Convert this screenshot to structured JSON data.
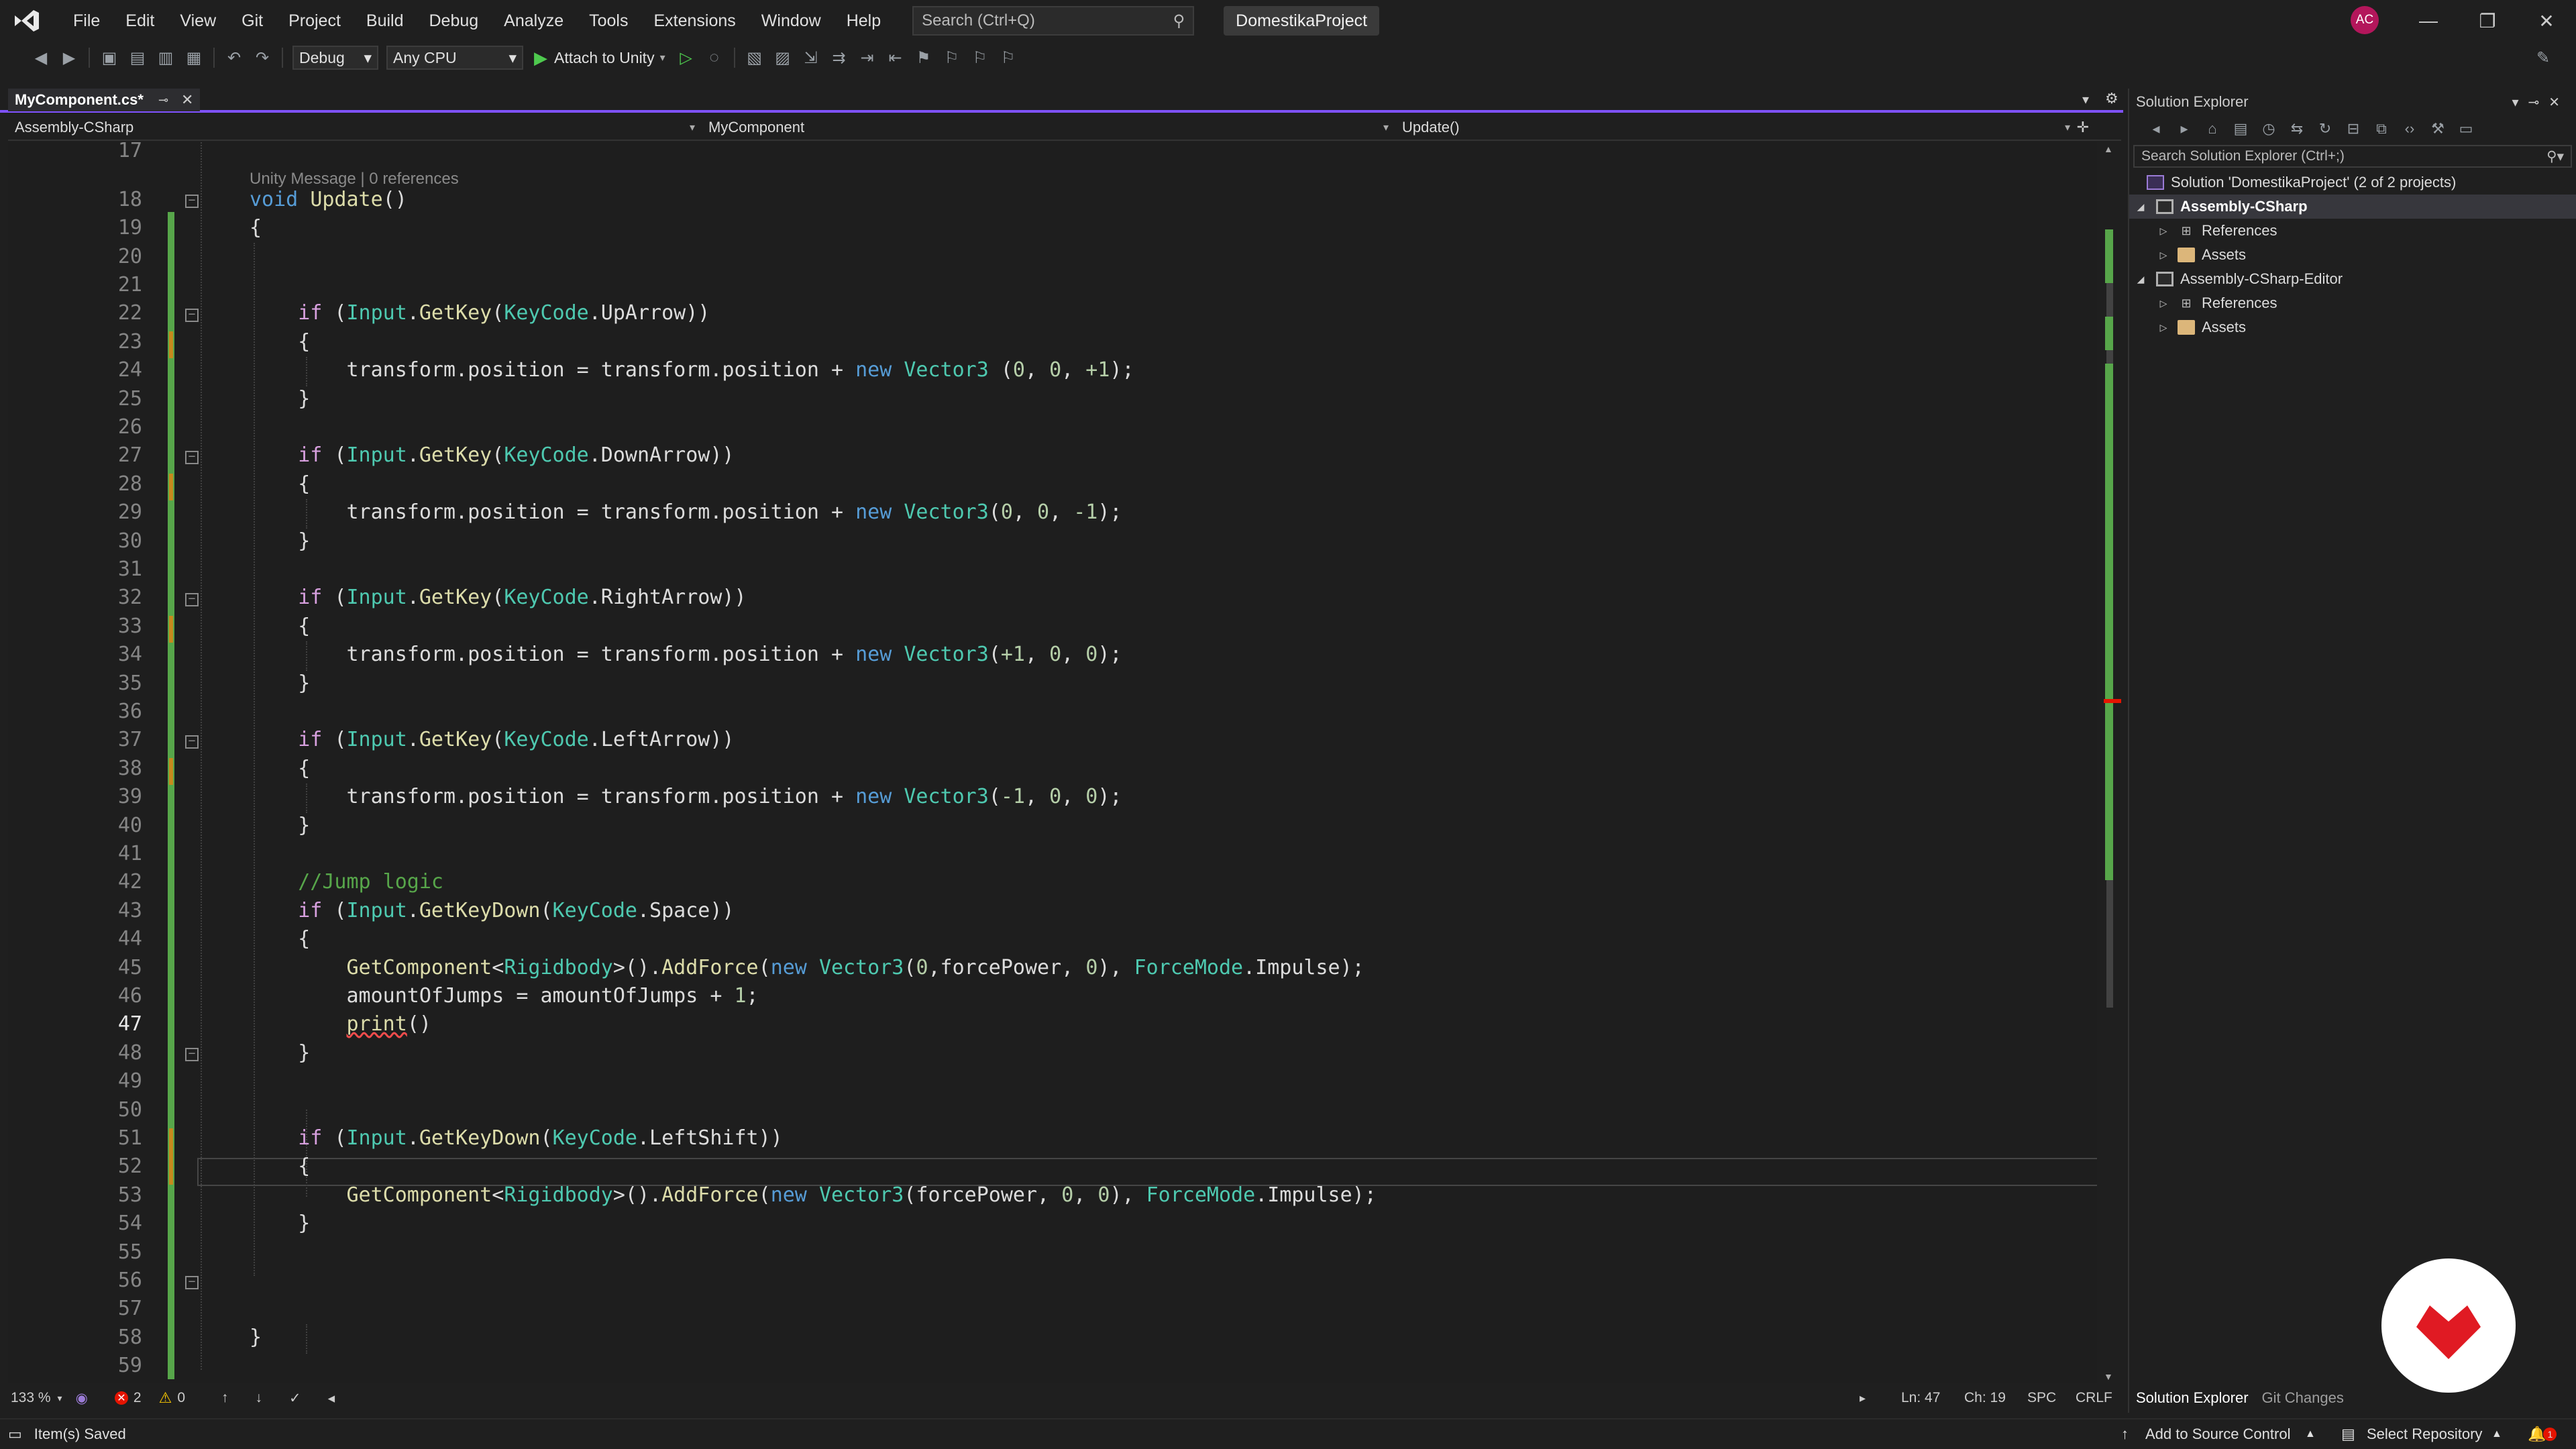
{
  "menu": [
    "File",
    "Edit",
    "View",
    "Git",
    "Project",
    "Build",
    "Debug",
    "Analyze",
    "Tools",
    "Extensions",
    "Window",
    "Help"
  ],
  "search": {
    "placeholder": "Search (Ctrl+Q)"
  },
  "project_name": "DomestikaProject",
  "user_initials": "AC",
  "toolbar": {
    "config": "Debug",
    "platform": "Any CPU",
    "attach": "Attach to Unity"
  },
  "tab": {
    "title": "MyComponent.cs*"
  },
  "nav": {
    "project": "Assembly-CSharp",
    "class": "MyComponent",
    "member": "Update()"
  },
  "codelens": "Unity Message | 0 references",
  "code_lines": [
    {
      "n": "17",
      "html": ""
    },
    {
      "n": "18",
      "html": "<span class='kw'>void</span> <span class='mth'>Update</span>()"
    },
    {
      "n": "19",
      "html": "{"
    },
    {
      "n": "20",
      "html": ""
    },
    {
      "n": "21",
      "html": ""
    },
    {
      "n": "22",
      "html": "    <span class='ctl'>if</span> (<span class='ty'>Input</span>.<span class='mth'>GetKey</span>(<span class='ty'>KeyCode</span>.UpArrow))"
    },
    {
      "n": "23",
      "html": "    {"
    },
    {
      "n": "24",
      "html": "        transform.position = transform.position + <span class='kw'>new</span> <span class='ty'>Vector3</span> (<span class='nm'>0</span>, <span class='nm'>0</span>, <span class='nm'>+1</span>);"
    },
    {
      "n": "25",
      "html": "    }"
    },
    {
      "n": "26",
      "html": ""
    },
    {
      "n": "27",
      "html": "    <span class='ctl'>if</span> (<span class='ty'>Input</span>.<span class='mth'>GetKey</span>(<span class='ty'>KeyCode</span>.DownArrow))"
    },
    {
      "n": "28",
      "html": "    {"
    },
    {
      "n": "29",
      "html": "        transform.position = transform.position + <span class='kw'>new</span> <span class='ty'>Vector3</span>(<span class='nm'>0</span>, <span class='nm'>0</span>, <span class='nm'>-1</span>);"
    },
    {
      "n": "30",
      "html": "    }"
    },
    {
      "n": "31",
      "html": ""
    },
    {
      "n": "32",
      "html": "    <span class='ctl'>if</span> (<span class='ty'>Input</span>.<span class='mth'>GetKey</span>(<span class='ty'>KeyCode</span>.RightArrow))"
    },
    {
      "n": "33",
      "html": "    {"
    },
    {
      "n": "34",
      "html": "        transform.position = transform.position + <span class='kw'>new</span> <span class='ty'>Vector3</span>(<span class='nm'>+1</span>, <span class='nm'>0</span>, <span class='nm'>0</span>);"
    },
    {
      "n": "35",
      "html": "    }"
    },
    {
      "n": "36",
      "html": ""
    },
    {
      "n": "37",
      "html": "    <span class='ctl'>if</span> (<span class='ty'>Input</span>.<span class='mth'>GetKey</span>(<span class='ty'>KeyCode</span>.LeftArrow))"
    },
    {
      "n": "38",
      "html": "    {"
    },
    {
      "n": "39",
      "html": "        transform.position = transform.position + <span class='kw'>new</span> <span class='ty'>Vector3</span>(<span class='nm'>-1</span>, <span class='nm'>0</span>, <span class='nm'>0</span>);"
    },
    {
      "n": "40",
      "html": "    }"
    },
    {
      "n": "41",
      "html": ""
    },
    {
      "n": "42",
      "html": "    <span class='cm'>//Jump logic</span>"
    },
    {
      "n": "43",
      "html": "    <span class='ctl'>if</span> (<span class='ty'>Input</span>.<span class='mth'>GetKeyDown</span>(<span class='ty'>KeyCode</span>.Space))"
    },
    {
      "n": "44",
      "html": "    {"
    },
    {
      "n": "45",
      "html": "        <span class='mth'>GetComponent</span>&lt;<span class='ty'>Rigidbody</span>&gt;().<span class='mth'>AddForce</span>(<span class='kw'>new</span> <span class='ty'>Vector3</span>(<span class='nm'>0</span>,forcePower, <span class='nm'>0</span>), <span class='ty'>ForceMode</span>.Impulse);"
    },
    {
      "n": "46",
      "html": "        amountOfJumps = amountOfJumps + <span class='nm'>1</span>;"
    },
    {
      "n": "47",
      "html": "        <span class='mth squiggle'>print</span>()"
    },
    {
      "n": "48",
      "html": "    }"
    },
    {
      "n": "49",
      "html": ""
    },
    {
      "n": "50",
      "html": ""
    },
    {
      "n": "51",
      "html": "    <span class='ctl'>if</span> (<span class='ty'>Input</span>.<span class='mth'>GetKeyDown</span>(<span class='ty'>KeyCode</span>.LeftShift))"
    },
    {
      "n": "52",
      "html": "    {"
    },
    {
      "n": "53",
      "html": "        <span class='mth'>GetComponent</span>&lt;<span class='ty'>Rigidbody</span>&gt;().<span class='mth'>AddForce</span>(<span class='kw'>new</span> <span class='ty'>Vector3</span>(forcePower, <span class='nm'>0</span>, <span class='nm'>0</span>), <span class='ty'>ForceMode</span>.Impulse);"
    },
    {
      "n": "54",
      "html": "    }"
    },
    {
      "n": "55",
      "html": ""
    },
    {
      "n": "56",
      "html": ""
    },
    {
      "n": "57",
      "html": ""
    },
    {
      "n": "58",
      "html": "}"
    },
    {
      "n": "59",
      "html": ""
    }
  ],
  "status": {
    "zoom": "133 %",
    "errors": "2",
    "warnings": "0",
    "line": "Ln: 47",
    "col": "Ch: 19",
    "spc": "SPC",
    "eol": "CRLF"
  },
  "solution_explorer": {
    "title": "Solution Explorer",
    "search_placeholder": "Search Solution Explorer (Ctrl+;)",
    "solution": "Solution 'DomestikaProject' (2 of 2 projects)",
    "project1": "Assembly-CSharp",
    "project2": "Assembly-CSharp-Editor",
    "references": "References",
    "assets": "Assets",
    "tab_se": "Solution Explorer",
    "tab_git": "Git Changes"
  },
  "bottom": {
    "saved": "Item(s) Saved",
    "source_control": "Add to Source Control",
    "repo": "Select Repository",
    "notif_count": "1"
  },
  "colors": {
    "accent": "#7f52ff",
    "error": "#e51400",
    "added": "#57a64a",
    "modified": "#c68a1d",
    "brand": "#e01a23"
  }
}
